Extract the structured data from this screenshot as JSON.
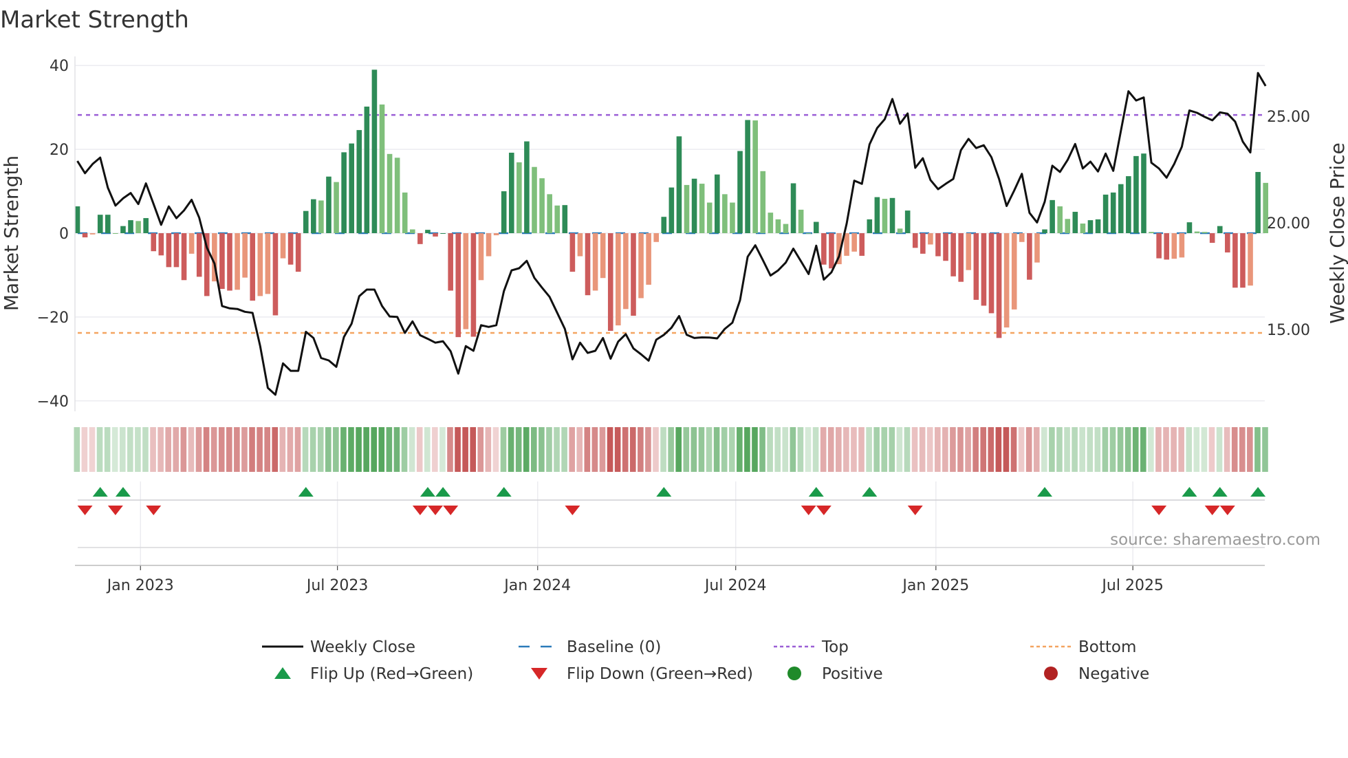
{
  "chart_data": {
    "type": "bar",
    "title": "Market Strength",
    "ylabel": "Market Strength",
    "y2label": "Weekly Close Price",
    "ylim": [
      -42,
      42
    ],
    "yticks": [
      40,
      20,
      0,
      -20,
      -40
    ],
    "ytick_labels": [
      "40",
      "20",
      "0",
      "−20",
      "−40"
    ],
    "y2lim": [
      11.5,
      27.8
    ],
    "y2ticks": [
      25,
      20,
      15
    ],
    "y2tick_labels": [
      "25.00",
      "20.00",
      "15.00"
    ],
    "start_date": "2022-11-04",
    "interval_days": 7,
    "xticks": [
      {
        "date": "2023-01-01",
        "label": "Jan 2023"
      },
      {
        "date": "2023-07-01",
        "label": "Jul 2023"
      },
      {
        "date": "2024-01-01",
        "label": "Jan 2024"
      },
      {
        "date": "2024-07-01",
        "label": "Jul 2024"
      },
      {
        "date": "2025-01-01",
        "label": "Jan 2025"
      },
      {
        "date": "2025-07-01",
        "label": "Jul 2025"
      }
    ],
    "top_level": 28.2,
    "bottom_level": -23.8,
    "baseline": 0,
    "strength": [
      6.4,
      -1,
      -0.3,
      4.4,
      4.4,
      0,
      1.7,
      3.1,
      2.9,
      3.6,
      -4.3,
      -5.3,
      -8.1,
      -8.1,
      -11.2,
      -4.9,
      -10.4,
      -15,
      -11.5,
      -13.3,
      -13.7,
      -13.5,
      -10.6,
      -16.1,
      -15,
      -14.5,
      -19.6,
      -6,
      -7.5,
      -9.2,
      5.3,
      8.1,
      7.8,
      13.5,
      12.2,
      19.3,
      21.4,
      24.6,
      30.2,
      39,
      30.7,
      18.9,
      18,
      9.7,
      0.9,
      -2.6,
      0.8,
      -0.8,
      0,
      -13.7,
      -24.8,
      -22.9,
      -24.7,
      -11.2,
      -5.5,
      -0.5,
      10,
      19.2,
      16.9,
      21.9,
      15.8,
      13.1,
      9.3,
      6.6,
      6.7,
      -9.2,
      -5.5,
      -14.8,
      -13.7,
      -10.7,
      -23.3,
      -22,
      -18.1,
      -19.7,
      -15.5,
      -12.3,
      -2.1,
      3.9,
      10.9,
      23.1,
      11.5,
      13,
      11.8,
      7.3,
      14,
      9.3,
      7.3,
      19.6,
      27,
      26.9,
      14.8,
      4.9,
      3.3,
      2.2,
      11.9,
      5.6,
      0,
      2.7,
      -7.5,
      -8.4,
      -7.4,
      -5.4,
      -4.4,
      -5.4,
      3.3,
      8.6,
      8.2,
      8.4,
      1.1,
      5.4,
      -3.5,
      -4.9,
      -2.7,
      -5.5,
      -6.6,
      -10.3,
      -11.6,
      -8.8,
      -15.9,
      -17.3,
      -19.1,
      -25,
      -22.5,
      -18.2,
      -2.1,
      -11.1,
      -7,
      0.9,
      7.9,
      6.4,
      3.4,
      5.1,
      2.3,
      3.1,
      3.3,
      9.2,
      9.7,
      11.7,
      13.6,
      18.4,
      19,
      0.3,
      -6,
      -6.3,
      -6.1,
      -5.8,
      2.6,
      0.4,
      0.3,
      -2.3,
      1.7,
      -4.6,
      -13,
      -13,
      -12.5,
      14.6,
      12
    ],
    "weekly_close": [
      22.9,
      22.33,
      22.76,
      23.06,
      21.65,
      20.81,
      21.15,
      21.4,
      20.88,
      21.85,
      20.88,
      19.91,
      20.77,
      20.22,
      20.58,
      21.08,
      20.24,
      18.84,
      18.09,
      16.1,
      15.99,
      15.96,
      15.83,
      15.78,
      14.22,
      12.26,
      11.94,
      13.41,
      13.06,
      13.06,
      14.89,
      14.6,
      13.66,
      13.55,
      13.25,
      14.65,
      15.27,
      16.56,
      16.87,
      16.87,
      16.1,
      15.61,
      15.59,
      14.84,
      15.38,
      14.73,
      14.56,
      14.38,
      14.45,
      13.98,
      12.93,
      14.22,
      14,
      15.2,
      15.12,
      15.2,
      16.8,
      17.77,
      17.87,
      18.22,
      17.42,
      16.96,
      16.53,
      15.78,
      15.03,
      13.6,
      14.38,
      13.9,
      14,
      14.6,
      13.63,
      14.43,
      14.78,
      14.11,
      13.84,
      13.54,
      14.52,
      14.75,
      15.08,
      15.63,
      14.75,
      14.6,
      14.63,
      14.62,
      14.58,
      15.03,
      15.32,
      16.37,
      18.41,
      18.95,
      18.25,
      17.53,
      17.77,
      18.14,
      18.79,
      18.2,
      17.6,
      18.93,
      17.34,
      17.68,
      18.43,
      19.97,
      21.98,
      21.83,
      23.68,
      24.45,
      24.86,
      25.81,
      24.65,
      25.13,
      22.58,
      23.03,
      22.01,
      21.58,
      21.83,
      22.06,
      23.41,
      23.94,
      23.51,
      23.64,
      23.08,
      22.06,
      20.79,
      21.52,
      22.3,
      20.47,
      20.02,
      20.99,
      22.68,
      22.39,
      22.95,
      23.7,
      22.55,
      22.87,
      22.41,
      23.25,
      22.44,
      24.32,
      26.17,
      25.74,
      25.88,
      22.82,
      22.55,
      22.12,
      22.76,
      23.57,
      25.27,
      25.16,
      24.97,
      24.81,
      25.18,
      25.12,
      24.75,
      23.81,
      23.3,
      27.03,
      26.42
    ],
    "flip_up_idx": [
      3,
      6,
      30,
      46,
      48,
      56,
      77,
      97,
      104,
      127,
      146,
      150,
      155
    ],
    "flip_down_idx": [
      1,
      5,
      10,
      45,
      47,
      49,
      65,
      96,
      98,
      110,
      142,
      149,
      151
    ],
    "legend": {
      "placement": "bottom",
      "items": [
        {
          "label": "Weekly Close",
          "type": "line"
        },
        {
          "label": "Baseline (0)",
          "type": "dash"
        },
        {
          "label": "Top",
          "type": "dot-purple"
        },
        {
          "label": "Bottom",
          "type": "dot-orange"
        },
        {
          "label": "Flip Up (Red→Green)",
          "type": "tri-up"
        },
        {
          "label": "Flip Down (Green→Red)",
          "type": "tri-down"
        },
        {
          "label": "Positive",
          "type": "circle-green"
        },
        {
          "label": "Negative",
          "type": "circle-red"
        }
      ]
    },
    "source": "source: sharemaestro.com"
  },
  "colors": {
    "pos_strong": "#2e8b57",
    "pos_weak": "#7fbf7b",
    "neg_strong": "#cd5c5c",
    "neg_weak": "#e9967a",
    "line": "#111111",
    "baseline": "#2b7bb9",
    "top": "#9b5fd6",
    "bottom": "#f4a460",
    "flip_up": "#1a9a4a",
    "flip_down": "#d62728",
    "positive": "#1f8a2a",
    "negative": "#b22222",
    "grid": "#ececf0"
  }
}
